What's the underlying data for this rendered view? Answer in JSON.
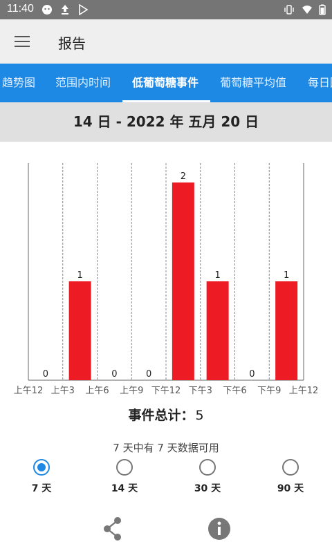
{
  "status_bar": {
    "time": "11:40"
  },
  "app_bar": {
    "title": "报告",
    "menu_icon": "hamburger-menu-icon"
  },
  "tabs": [
    {
      "label": "趋势图",
      "active": false
    },
    {
      "label": "范围内时间",
      "active": false
    },
    {
      "label": "低葡萄糖事件",
      "active": true
    },
    {
      "label": "葡萄糖平均值",
      "active": false
    },
    {
      "label": "每日图",
      "active": false
    }
  ],
  "date_range": "14 日 - 2022 年 五月 20 日",
  "chart_data": {
    "type": "bar",
    "categories": [
      "上午12",
      "上午3",
      "上午6",
      "上午9",
      "下午12",
      "下午3",
      "下午6",
      "下午9"
    ],
    "x_tick_labels": [
      "上午12",
      "上午3",
      "上午6",
      "上午9",
      "下午12",
      "下午3",
      "下午6",
      "下午9",
      "上午12"
    ],
    "values": [
      0,
      1,
      0,
      0,
      2,
      1,
      0,
      1
    ],
    "value_labels": [
      "0",
      "1",
      "0",
      "0",
      "2",
      "1",
      "0",
      "1"
    ],
    "ylim": [
      0,
      2
    ],
    "bar_color": "#ed1c24",
    "grid": "vertical dashed",
    "title": "",
    "xlabel": "",
    "ylabel": ""
  },
  "summary": {
    "label": "事件总计：",
    "value": "5"
  },
  "availability_text": "7 天中有 7 天数据可用",
  "ranges": [
    {
      "label": "7 天",
      "selected": true
    },
    {
      "label": "14 天",
      "selected": false
    },
    {
      "label": "30 天",
      "selected": false
    },
    {
      "label": "90 天",
      "selected": false
    }
  ],
  "actions": {
    "share_icon": "share-icon",
    "info_icon": "info-icon"
  },
  "colors": {
    "accent": "#1e88e5",
    "bar": "#ed1c24",
    "status_bar": "#757575",
    "app_bar": "#efefef"
  }
}
